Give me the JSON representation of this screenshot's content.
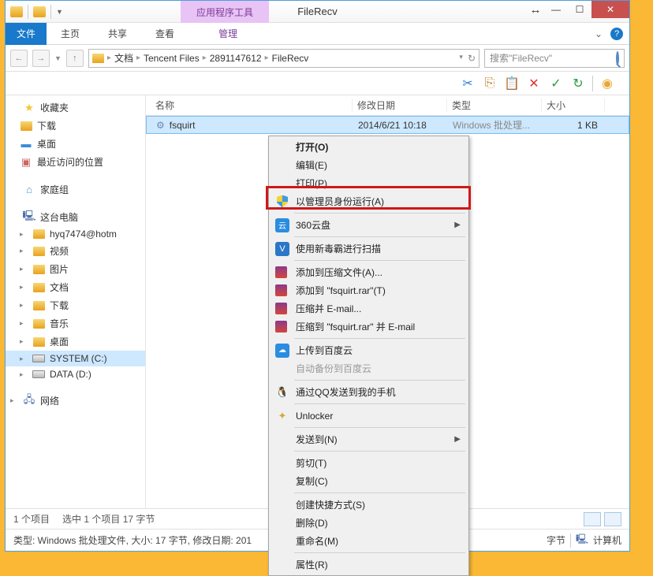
{
  "window": {
    "title": "FileRecv",
    "tools_tab": "应用程序工具"
  },
  "ribbon": {
    "file": "文件",
    "tabs": [
      "主页",
      "共享",
      "查看",
      "管理"
    ]
  },
  "nav": {
    "crumbs": [
      "文档",
      "Tencent Files",
      "2891147612",
      "FileRecv"
    ],
    "search_placeholder": "搜索\"FileRecv\""
  },
  "columns": {
    "name": "名称",
    "date": "修改日期",
    "type": "类型",
    "size": "大小"
  },
  "file": {
    "name": "fsquirt",
    "date": "2014/6/21 10:18",
    "type": "Windows 批处理...",
    "size": "1 KB"
  },
  "sidebar": {
    "favorites": "收藏夹",
    "fav_items": [
      "下载",
      "桌面",
      "最近访问的位置"
    ],
    "homegroup": "家庭组",
    "this_pc": "这台电脑",
    "pc_items": [
      "hyq7474@hotm",
      "视频",
      "图片",
      "文档",
      "下载",
      "音乐",
      "桌面",
      "SYSTEM (C:)",
      "DATA (D:)"
    ],
    "network": "网络"
  },
  "status": {
    "count": "1 个项目",
    "selected": "选中 1 个项目 17 字节"
  },
  "details": {
    "line": "类型: Windows 批处理文件, 大小: 17 字节, 修改日期: 201",
    "bytes": "字节",
    "computer": "计算机"
  },
  "context_menu": {
    "open": "打开(O)",
    "edit": "编辑(E)",
    "print": "打印(P)",
    "run_admin": "以管理员身份运行(A)",
    "cloud360": "360云盘",
    "scan": "使用新毒霸进行扫描",
    "add_archive": "添加到压缩文件(A)...",
    "add_rar": "添加到 \"fsquirt.rar\"(T)",
    "compress_email": "压缩并 E-mail...",
    "compress_rar_email": "压缩到 \"fsquirt.rar\" 并 E-mail",
    "upload_baidu": "上传到百度云",
    "auto_backup": "自动备份到百度云",
    "qq_send": "通过QQ发送到我的手机",
    "unlocker": "Unlocker",
    "send_to": "发送到(N)",
    "cut": "剪切(T)",
    "copy": "复制(C)",
    "shortcut": "创建快捷方式(S)",
    "delete": "删除(D)",
    "rename": "重命名(M)",
    "properties": "属性(R)"
  }
}
